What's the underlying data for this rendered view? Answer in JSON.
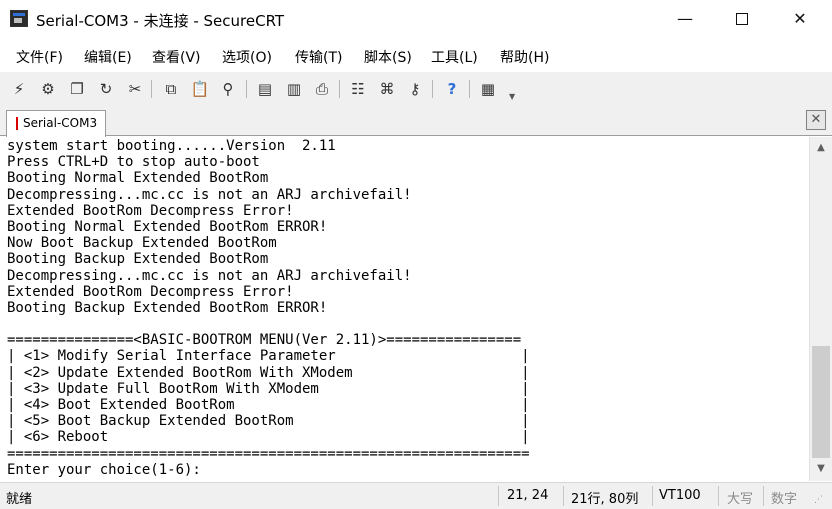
{
  "window": {
    "title": "Serial-COM3 - 未连接 - SecureCRT",
    "minimize_glyph": "—",
    "close_glyph": "✕"
  },
  "menu": [
    "文件(F)",
    "编辑(E)",
    "查看(V)",
    "选项(O)",
    "传输(T)",
    "脚本(S)",
    "工具(L)",
    "帮助(H)"
  ],
  "toolbar": {
    "icons": [
      {
        "name": "connect-icon",
        "glyph": "⚡"
      },
      {
        "name": "quick-connect-icon",
        "glyph": "⚙"
      },
      {
        "name": "connect-in-tab-icon",
        "glyph": "❐"
      },
      {
        "name": "reconnect-icon",
        "glyph": "↻"
      },
      {
        "name": "disconnect-icon",
        "glyph": "✂"
      },
      {
        "name": "copy-icon",
        "glyph": "⧉"
      },
      {
        "name": "paste-icon",
        "glyph": "📋"
      },
      {
        "name": "find-icon",
        "glyph": "⚲"
      },
      {
        "name": "print-preview-icon",
        "glyph": "▤"
      },
      {
        "name": "print-setup-icon",
        "glyph": "▥"
      },
      {
        "name": "print-icon",
        "glyph": "⎙"
      },
      {
        "name": "session-options-icon",
        "glyph": "☷"
      },
      {
        "name": "keymap-icon",
        "glyph": "⌘"
      },
      {
        "name": "key-agent-icon",
        "glyph": "⚷"
      },
      {
        "name": "help-icon",
        "glyph": "?"
      },
      {
        "name": "map-icon",
        "glyph": "▦"
      }
    ],
    "colors": {
      "help": "#2f6fd6",
      "connect": "#c8a020",
      "reconnect": "#2a8a2a"
    }
  },
  "tabs": [
    {
      "label": "Serial-COM3",
      "status_color": "#d90000"
    }
  ],
  "tab_close_glyph": "✕",
  "terminal": {
    "lines": [
      "system start booting......Version  2.11",
      "Press CTRL+D to stop auto-boot",
      "Booting Normal Extended BootRom",
      "Decompressing...mc.cc is not an ARJ archivefail!",
      "Extended BootRom Decompress Error!",
      "Booting Normal Extended BootRom ERROR!",
      "Now Boot Backup Extended BootRom",
      "Booting Backup Extended BootRom",
      "Decompressing...mc.cc is not an ARJ archivefail!",
      "Extended BootRom Decompress Error!",
      "Booting Backup Extended BootRom ERROR!",
      "",
      "===============<BASIC-BOOTROM MENU(Ver 2.11)>================",
      "| <1> Modify Serial Interface Parameter                      |",
      "| <2> Update Extended BootRom With XModem                    |",
      "| <3> Update Full BootRom With XModem                        |",
      "| <4> Boot Extended BootRom                                  |",
      "| <5> Boot Backup Extended BootRom                           |",
      "| <6> Reboot                                                 |",
      "==============================================================",
      "Enter your choice(1-6):"
    ]
  },
  "scrollbar": {
    "up_glyph": "▲",
    "down_glyph": "▼"
  },
  "status": {
    "state": "就绪",
    "cursor": "21,  24",
    "rows_cols": "21行, 80列",
    "emulation": "VT100",
    "caps": "大写",
    "num": "数字",
    "grip_glyph": "⋰"
  }
}
